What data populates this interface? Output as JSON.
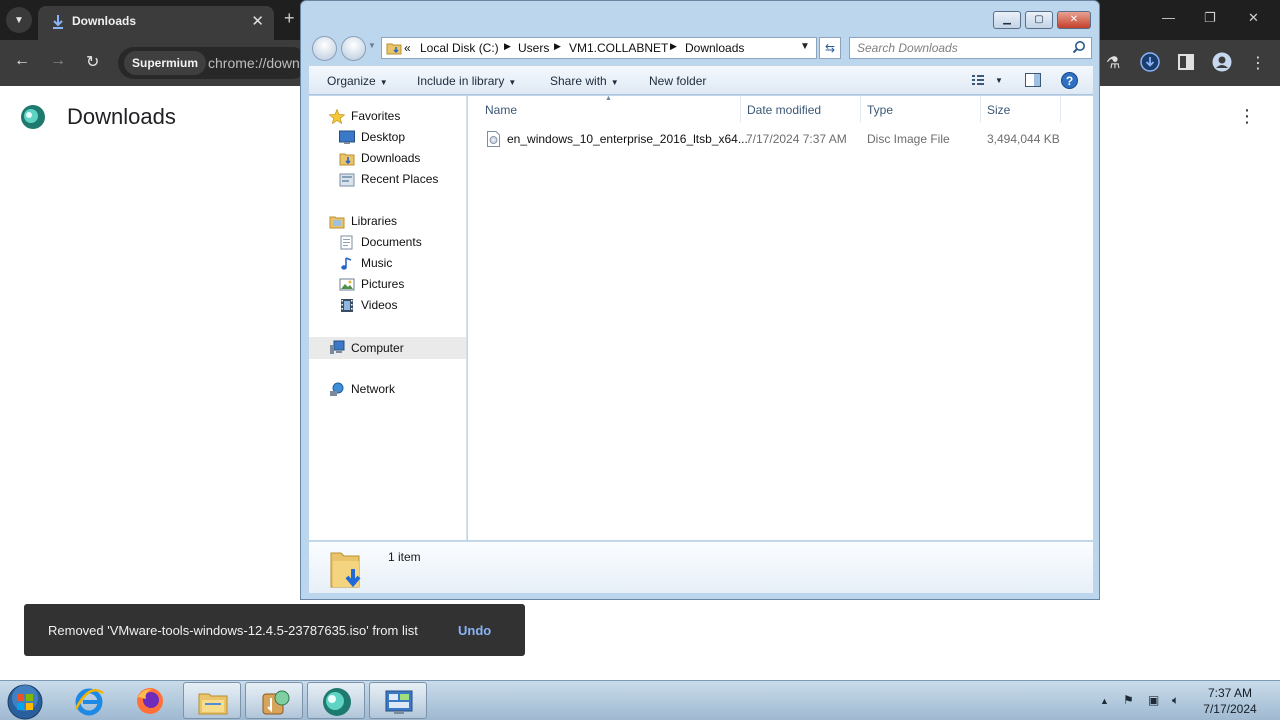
{
  "chrome": {
    "tab_title": "Downloads",
    "site_chip": "Supermium",
    "url": "chrome://downloads"
  },
  "downloads_page": {
    "title": "Downloads"
  },
  "toast": {
    "message": "Removed 'VMware-tools-windows-12.4.5-23787635.iso' from list",
    "undo_label": "Undo"
  },
  "explorer": {
    "breadcrumb": {
      "overflow": "«",
      "items": [
        "Local Disk (C:)",
        "Users",
        "VM1.COLLABNET",
        "Downloads"
      ]
    },
    "search_placeholder": "Search Downloads",
    "commands": {
      "organize": "Organize",
      "include_in_library": "Include in library",
      "share_with": "Share with",
      "new_folder": "New folder"
    },
    "nav": {
      "favorites": "Favorites",
      "desktop": "Desktop",
      "downloads": "Downloads",
      "recent_places": "Recent Places",
      "libraries": "Libraries",
      "documents": "Documents",
      "music": "Music",
      "pictures": "Pictures",
      "videos": "Videos",
      "computer": "Computer",
      "network": "Network"
    },
    "columns": {
      "name": "Name",
      "date_modified": "Date modified",
      "type": "Type",
      "size": "Size"
    },
    "files": [
      {
        "name": "en_windows_10_enterprise_2016_ltsb_x64...",
        "date_modified": "7/17/2024 7:37 AM",
        "type": "Disc Image File",
        "size": "3,494,044 KB"
      }
    ],
    "item_count": "1 item"
  },
  "taskbar": {
    "time": "7:37 AM",
    "date": "7/17/2024"
  },
  "colors": {
    "chrome_dark": "#1f1f1f",
    "chrome_toolbar": "#3c3c3c",
    "toast_bg": "#323232",
    "toast_action": "#8ab4f8",
    "explorer_frame": "#bcd6ee",
    "column_header_text": "#3b5877",
    "taskbar": "#b4cce0"
  },
  "icons": {
    "tab_favicon": "download-arrow-icon",
    "page_logo": "supermium-logo-icon",
    "explorer_help": "help-icon",
    "ie": "internet-explorer-icon",
    "firefox": "firefox-icon"
  }
}
